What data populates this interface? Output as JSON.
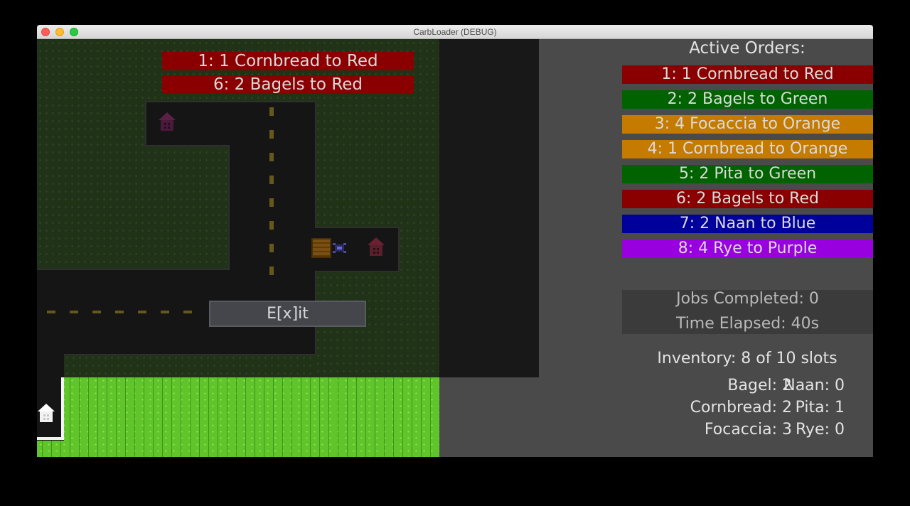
{
  "window": {
    "title": "CarbLoader (DEBUG)"
  },
  "map": {
    "claimed_orders": [
      "1: 1 Cornbread to Red",
      "6: 2 Bagels to Red"
    ],
    "exit_label": "E[x]it"
  },
  "orders": {
    "title": "Active Orders:",
    "items": [
      {
        "label": "1: 1 Cornbread to Red",
        "color": "#8a0000"
      },
      {
        "label": "2: 2 Bagels to Green",
        "color": "#006300"
      },
      {
        "label": "3: 4 Focaccia to Orange",
        "color": "#c57a00"
      },
      {
        "label": "4: 1 Cornbread to Orange",
        "color": "#c57a00"
      },
      {
        "label": "5: 2 Pita to Green",
        "color": "#006300"
      },
      {
        "label": "6: 2 Bagels to Red",
        "color": "#8a0000"
      },
      {
        "label": "7: 2 Naan to Blue",
        "color": "#00009a"
      },
      {
        "label": "8: 4 Rye to Purple",
        "color": "#9800e0"
      }
    ]
  },
  "stats": {
    "jobs_completed": "Jobs Completed: 0",
    "time_elapsed": "Time Elapsed: 40s"
  },
  "inventory": {
    "title": "Inventory: 8 of 10 slots",
    "bagel": "Bagel: 2",
    "cornbread": "Cornbread: 2",
    "focaccia": "Focaccia: 3",
    "naan": "Naan: 0",
    "pita": "Pita: 1",
    "rye": "Rye: 0"
  },
  "icons": [
    "house-icon",
    "crate-icon",
    "truck-icon"
  ]
}
